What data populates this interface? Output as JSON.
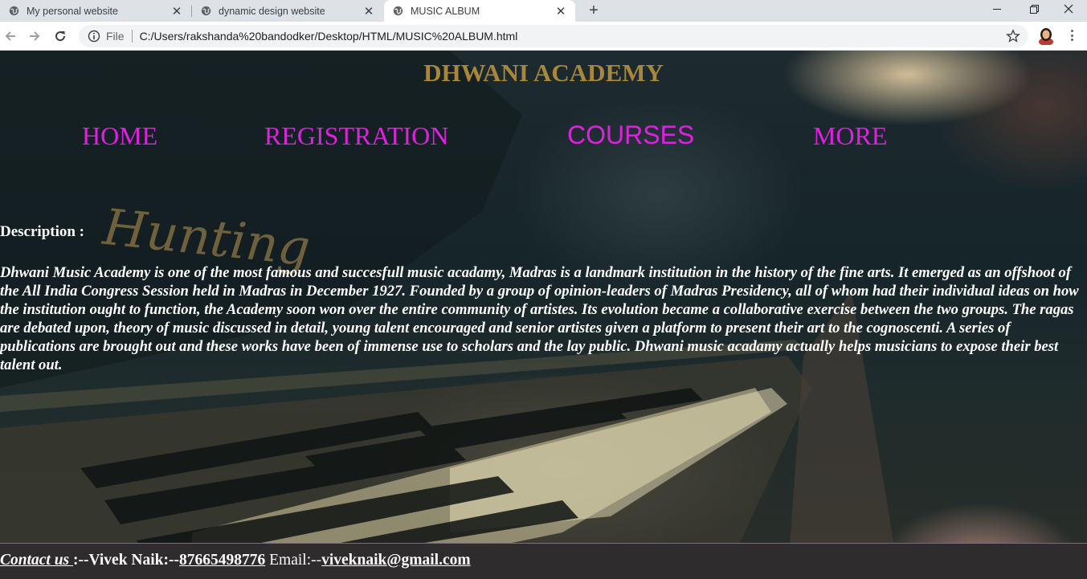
{
  "browser": {
    "tabs": [
      {
        "title": "My personal website",
        "active": false
      },
      {
        "title": "dynamic design website",
        "active": false
      },
      {
        "title": "MUSIC ALBUM",
        "active": true
      }
    ],
    "address": {
      "scheme_label": "File",
      "url": "C:/Users/rakshanda%20bandodker/Desktop/HTML/MUSIC%20ALBUM.html"
    },
    "icons": [
      "back-icon",
      "forward-icon",
      "reload-icon",
      "info-icon",
      "star-icon",
      "minimize-icon",
      "maximize-icon",
      "close-icon",
      "new-tab-icon",
      "menu-icon"
    ]
  },
  "page": {
    "title": "DHWANI ACADEMY",
    "nav": {
      "home": "HOME",
      "registration": "REGISTRATION",
      "courses": "COURSES",
      "more": "MORE"
    },
    "description_label": "Description :",
    "description": "Dhwani Music Academy is one of the most famous and succesfull music acadamy, Madras is a landmark institution in the history of the fine arts. It emerged as an offshoot of the All India Congress Session held in Madras in December 1927. Founded by a group of opinion-leaders of Madras Presidency, all of whom had their individual ideas on how the institution ought to function, the Academy soon won over the entire community of artistes. Its evolution became a collaborative exercise between the two groups. The ragas are debated upon, theory of music discussed in detail, young talent encouraged and senior artistes given a platform to present their art to the cognoscenti. A series of publications are brought out and these works have been of immense use to scholars and the lay public. Dhwani music acadamy actually helps musicians to expose their best talent out.",
    "footer": {
      "contact_label": "Contact us ",
      "sep1": ":--",
      "name": "Vivek Naik:--",
      "phone": "87665498776",
      "email_label": " Email:--",
      "email": "viveknaik@gmail.com"
    },
    "colors": {
      "title": "#a8863a",
      "nav": "#e020e0",
      "footer_bg": "#2f2c2e"
    }
  }
}
